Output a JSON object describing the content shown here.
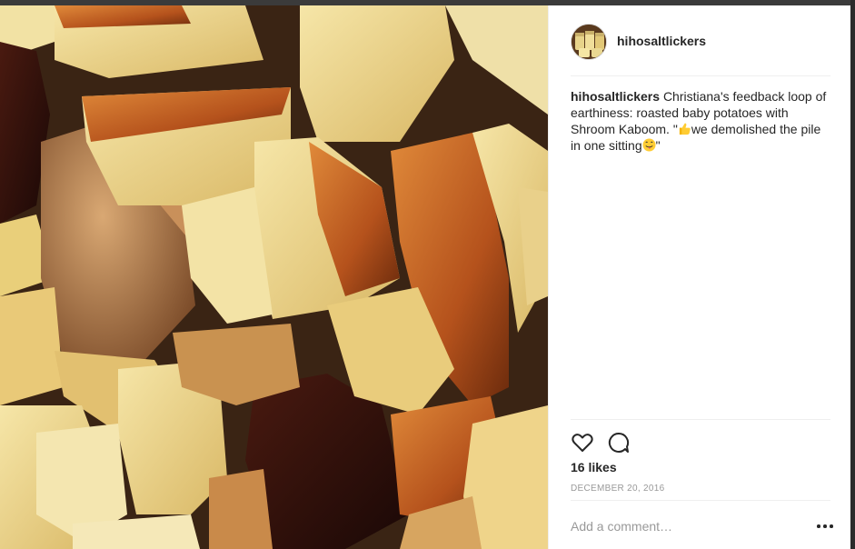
{
  "post": {
    "username": "hihosaltlickers",
    "caption_user": "hihosaltlickers",
    "caption_part1": "Christiana's feedback loop of earthiness: roasted baby potatoes with Shroom Kaboom. \"",
    "caption_part2": "we demolished the pile in one sitting",
    "caption_part3": "\"",
    "likes": "16 likes",
    "date": "DECEMBER 20, 2016"
  },
  "icons": {
    "like": "heart-outline-icon",
    "comment": "speech-bubble-icon",
    "more": "ellipsis-icon",
    "emoji1": "thumbs-up-emoji",
    "emoji2": "tongue-out-face-emoji"
  },
  "comment_box": {
    "placeholder": "Add a comment…"
  },
  "colors": {
    "text": "#262626",
    "muted": "#999999",
    "divider": "#efefef"
  }
}
